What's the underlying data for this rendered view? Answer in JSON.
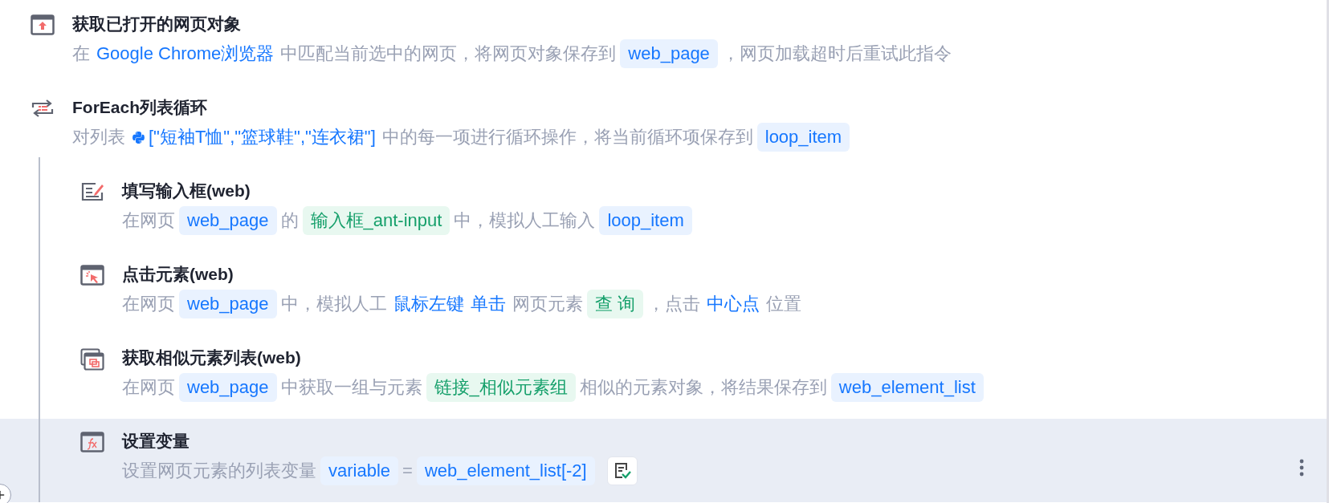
{
  "steps": [
    {
      "kind": "browser",
      "title": "获取已打开的网页对象",
      "selected": false,
      "segments": [
        {
          "kind": "text",
          "text": "在"
        },
        {
          "kind": "link",
          "text": "Google Chrome浏览器"
        },
        {
          "kind": "text",
          "text": "中匹配当前选中的网页，将网页对象保存到"
        },
        {
          "kind": "var",
          "text": "web_page"
        },
        {
          "kind": "text",
          "text": "，网页加载超时后重试此指令"
        }
      ]
    },
    {
      "kind": "loop",
      "title": "ForEach列表循环",
      "selected": false,
      "segments": [
        {
          "kind": "text",
          "text": "对列表"
        },
        {
          "kind": "python",
          "text": "[\"短袖T恤\",\"篮球鞋\",\"连衣裙\"]"
        },
        {
          "kind": "text",
          "text": "中的每一项进行循环操作，将当前循环项保存到"
        },
        {
          "kind": "var",
          "text": "loop_item"
        }
      ],
      "children": [
        {
          "kind": "input",
          "title": "填写输入框(web)",
          "selected": false,
          "segments": [
            {
              "kind": "text",
              "text": "在网页"
            },
            {
              "kind": "var",
              "text": "web_page"
            },
            {
              "kind": "text",
              "text": "的"
            },
            {
              "kind": "element",
              "text": "输入框_ant-input"
            },
            {
              "kind": "text",
              "text": "中，模拟人工输入"
            },
            {
              "kind": "var",
              "text": "loop_item"
            }
          ]
        },
        {
          "kind": "click",
          "title": "点击元素(web)",
          "selected": false,
          "segments": [
            {
              "kind": "text",
              "text": "在网页"
            },
            {
              "kind": "var",
              "text": "web_page"
            },
            {
              "kind": "text",
              "text": "中，模拟人工"
            },
            {
              "kind": "link",
              "text": "鼠标左键"
            },
            {
              "kind": "link",
              "text": "单击"
            },
            {
              "kind": "text",
              "text": "网页元素"
            },
            {
              "kind": "element",
              "text": "查 询"
            },
            {
              "kind": "text",
              "text": "，点击"
            },
            {
              "kind": "link",
              "text": "中心点"
            },
            {
              "kind": "text",
              "text": "位置"
            }
          ]
        },
        {
          "kind": "similar",
          "title": "获取相似元素列表(web)",
          "selected": false,
          "segments": [
            {
              "kind": "text",
              "text": "在网页"
            },
            {
              "kind": "var",
              "text": "web_page"
            },
            {
              "kind": "text",
              "text": "中获取一组与元素"
            },
            {
              "kind": "element",
              "text": "链接_相似元素组"
            },
            {
              "kind": "text",
              "text": "相似的元素对象，将结果保存到"
            },
            {
              "kind": "var",
              "text": "web_element_list"
            }
          ]
        },
        {
          "kind": "fx",
          "title": "设置变量",
          "selected": true,
          "segments": [
            {
              "kind": "text",
              "text": "设置网页元素的列表变量"
            },
            {
              "kind": "var",
              "text": "variable"
            },
            {
              "kind": "text",
              "text": "="
            },
            {
              "kind": "var",
              "text": "web_element_list[-2]"
            },
            {
              "kind": "note"
            }
          ]
        }
      ]
    }
  ]
}
